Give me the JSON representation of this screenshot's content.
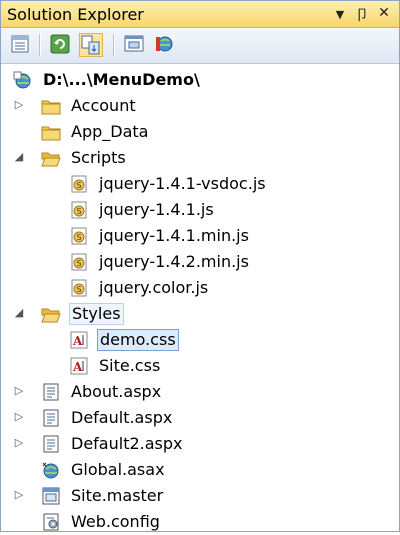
{
  "panel": {
    "title": "Solution Explorer",
    "dropdown_glyph": "▼",
    "pin_glyph": "卩",
    "close_glyph": "✕"
  },
  "toolbar": {
    "buttons": [
      {
        "name": "properties-icon"
      },
      {
        "name": "refresh-icon"
      },
      {
        "name": "nest-related-files-icon"
      },
      {
        "name": "view-designer-icon"
      },
      {
        "name": "copy-website-icon"
      }
    ]
  },
  "tree": {
    "root": {
      "label": "D:\\...\\MenuDemo\\"
    },
    "items": [
      {
        "label": "Account",
        "icon": "folder-icon",
        "expander": "collapsed"
      },
      {
        "label": "App_Data",
        "icon": "folder-icon",
        "expander": "none"
      },
      {
        "label": "Scripts",
        "icon": "folder-open-icon",
        "expander": "expanded"
      },
      {
        "label": "jquery-1.4.1-vsdoc.js",
        "icon": "js-file-icon",
        "expander": "none"
      },
      {
        "label": "jquery-1.4.1.js",
        "icon": "js-file-icon",
        "expander": "none"
      },
      {
        "label": "jquery-1.4.1.min.js",
        "icon": "js-file-icon",
        "expander": "none"
      },
      {
        "label": "jquery-1.4.2.min.js",
        "icon": "js-file-icon",
        "expander": "none"
      },
      {
        "label": "jquery.color.js",
        "icon": "js-file-icon",
        "expander": "none"
      },
      {
        "label": "Styles",
        "icon": "folder-open-icon",
        "expander": "expanded"
      },
      {
        "label": "demo.css",
        "icon": "css-file-icon",
        "expander": "none",
        "state": "selected"
      },
      {
        "label": "Site.css",
        "icon": "css-file-icon",
        "expander": "none"
      },
      {
        "label": "About.aspx",
        "icon": "aspx-file-icon",
        "expander": "collapsed"
      },
      {
        "label": "Default.aspx",
        "icon": "aspx-file-icon",
        "expander": "collapsed"
      },
      {
        "label": "Default2.aspx",
        "icon": "aspx-file-icon",
        "expander": "collapsed"
      },
      {
        "label": "Global.asax",
        "icon": "asax-file-icon",
        "expander": "none"
      },
      {
        "label": "Site.master",
        "icon": "master-file-icon",
        "expander": "collapsed"
      },
      {
        "label": "Web.config",
        "icon": "config-file-icon",
        "expander": "none"
      }
    ]
  },
  "colors": {
    "title_bg": "#f9df86",
    "selection": "#dcebfc",
    "selection_border": "#7da2ce"
  }
}
